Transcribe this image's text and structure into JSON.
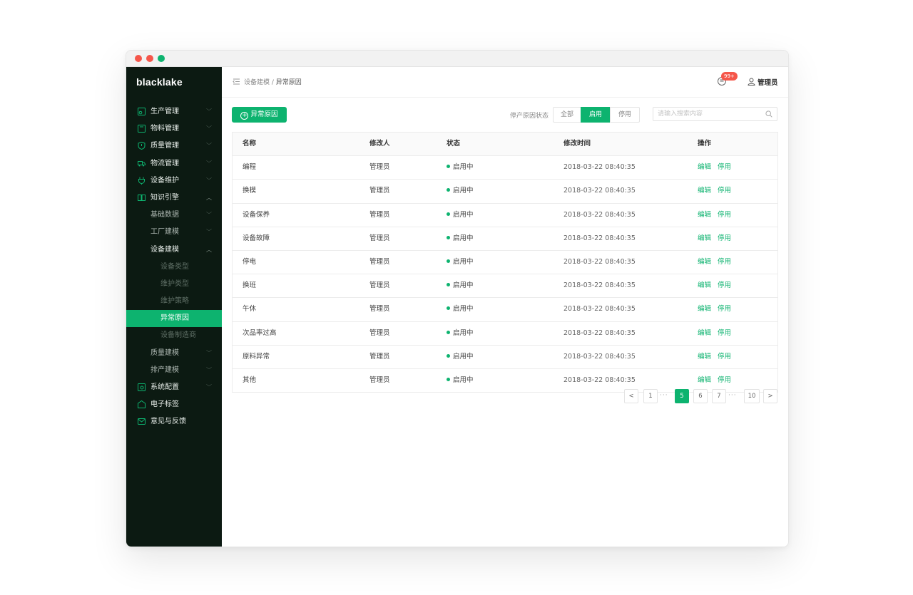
{
  "app": {
    "logo": "blacklake"
  },
  "sidebar": {
    "items": [
      {
        "label": "生产管理",
        "icon": "production-icon"
      },
      {
        "label": "物料管理",
        "icon": "material-icon"
      },
      {
        "label": "质量管理",
        "icon": "quality-shield-icon"
      },
      {
        "label": "物流管理",
        "icon": "truck-icon"
      },
      {
        "label": "设备维护",
        "icon": "plug-icon"
      },
      {
        "label": "知识引擎",
        "icon": "book-icon"
      },
      {
        "label": "基础数据"
      },
      {
        "label": "工厂建模"
      },
      {
        "label": "设备建模"
      },
      {
        "label": "设备类型"
      },
      {
        "label": "维护类型"
      },
      {
        "label": "维护策略"
      },
      {
        "label": "异常原因"
      },
      {
        "label": "设备制造商"
      },
      {
        "label": "质量建模"
      },
      {
        "label": "排产建模"
      },
      {
        "label": "系统配置",
        "icon": "settings-icon"
      },
      {
        "label": "电子标签",
        "icon": "tag-icon"
      },
      {
        "label": "意见与反馈",
        "icon": "mail-icon"
      }
    ]
  },
  "header": {
    "breadcrumb_parent": "设备建模",
    "breadcrumb_sep": " / ",
    "breadcrumb_current": "异常原因",
    "badge": "99+",
    "user": "管理员"
  },
  "toolbar": {
    "add_label": "异常原因",
    "filter_label": "停产原因状态",
    "filter_options": [
      "全部",
      "启用",
      "停用"
    ],
    "filter_selected": "启用",
    "search_placeholder": "请输入搜索内容"
  },
  "table": {
    "columns": [
      "名称",
      "修改人",
      "状态",
      "修改时间",
      "操作"
    ],
    "rows": [
      {
        "name": "编程",
        "modifier": "管理员",
        "status": "启用中",
        "time": "2018-03-22 08:40:35"
      },
      {
        "name": "换模",
        "modifier": "管理员",
        "status": "启用中",
        "time": "2018-03-22 08:40:35"
      },
      {
        "name": "设备保养",
        "modifier": "管理员",
        "status": "启用中",
        "time": "2018-03-22 08:40:35"
      },
      {
        "name": "设备故障",
        "modifier": "管理员",
        "status": "启用中",
        "time": "2018-03-22 08:40:35"
      },
      {
        "name": "停电",
        "modifier": "管理员",
        "status": "启用中",
        "time": "2018-03-22 08:40:35"
      },
      {
        "name": "换班",
        "modifier": "管理员",
        "status": "启用中",
        "time": "2018-03-22 08:40:35"
      },
      {
        "name": "午休",
        "modifier": "管理员",
        "status": "启用中",
        "time": "2018-03-22 08:40:35"
      },
      {
        "name": "次品率过高",
        "modifier": "管理员",
        "status": "启用中",
        "time": "2018-03-22 08:40:35"
      },
      {
        "name": "原料异常",
        "modifier": "管理员",
        "status": "启用中",
        "time": "2018-03-22 08:40:35"
      },
      {
        "name": "其他",
        "modifier": "管理员",
        "status": "启用中",
        "time": "2018-03-22 08:40:35"
      }
    ],
    "action_edit": "编辑",
    "action_disable": "停用"
  },
  "pagination": {
    "prev": "<",
    "next": ">",
    "first": "1",
    "ellipsis": "···",
    "pages": [
      "5",
      "6",
      "7"
    ],
    "current": "5",
    "last": "10"
  },
  "colors": {
    "accent": "#0db36f",
    "sidebar_bg": "#0c1a12",
    "badge": "#f5564a"
  }
}
